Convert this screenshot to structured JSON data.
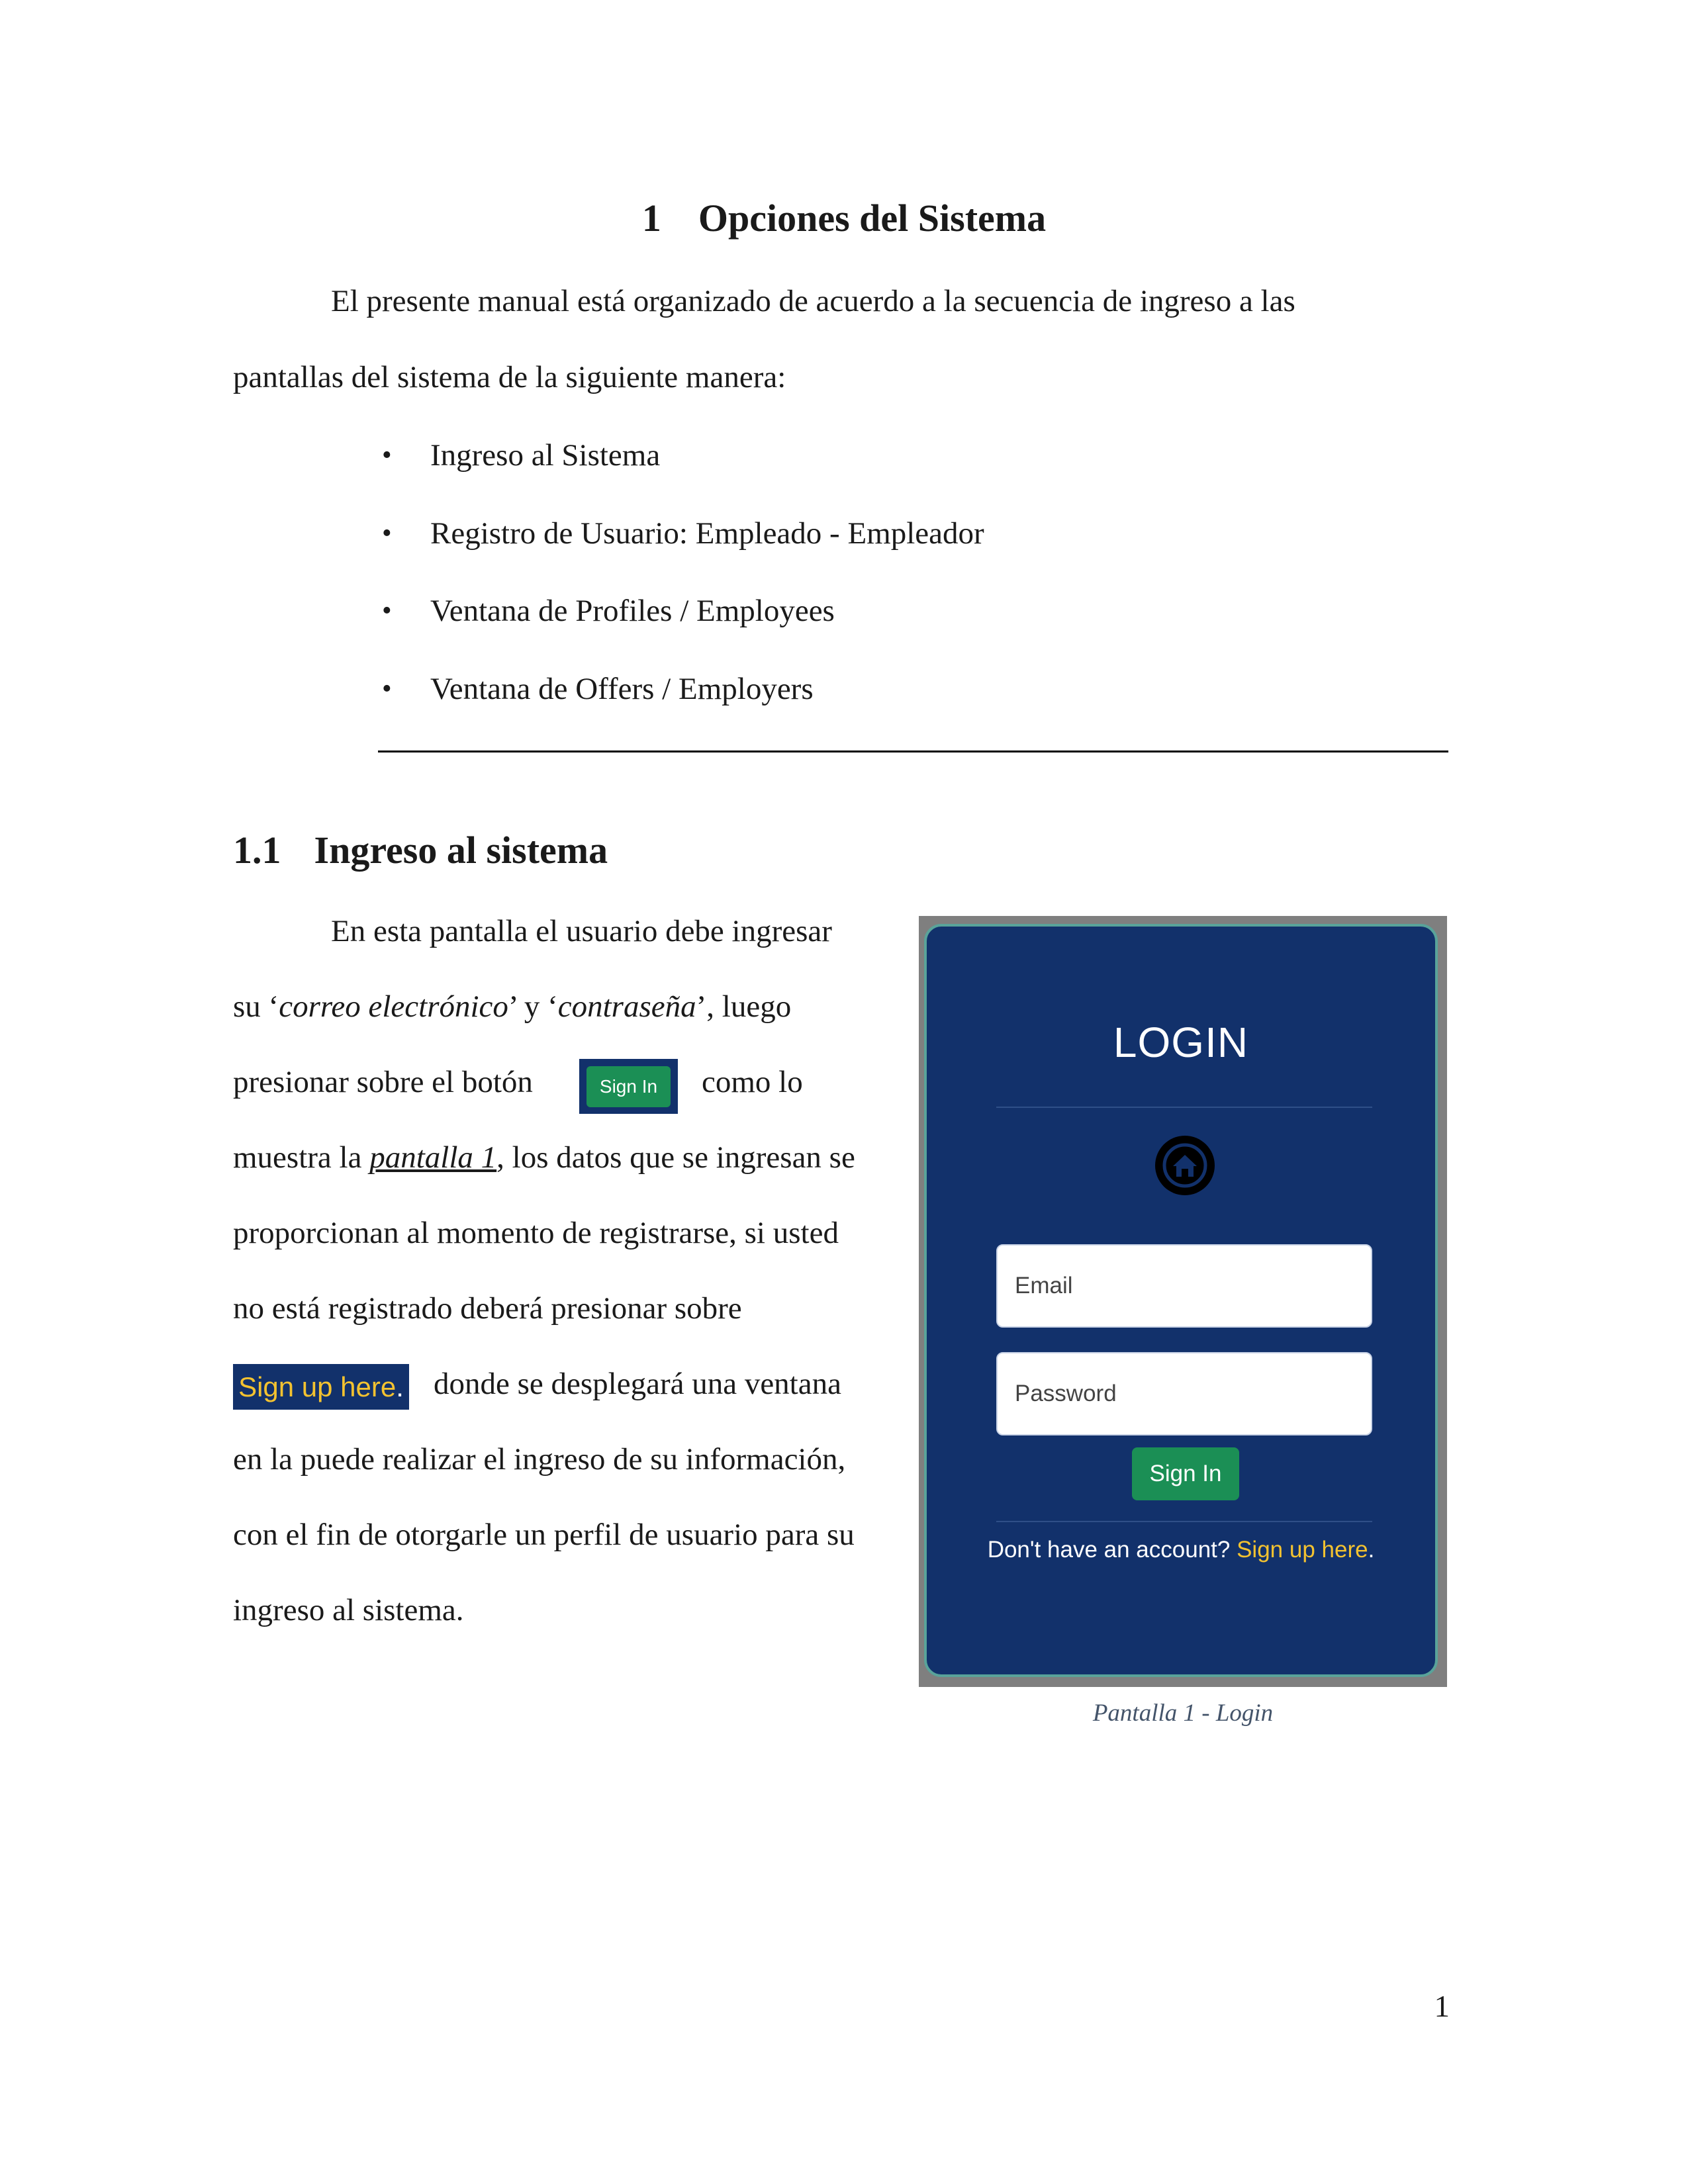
{
  "section": {
    "number": "1",
    "title": "Opciones del Sistema",
    "intro_line1": "El presente manual está organizado de acuerdo a la secuencia de ingreso a las",
    "intro_line2": "pantallas del sistema de la siguiente manera:",
    "bullets": [
      "Ingreso al Sistema",
      "Registro de Usuario: Empleado - Empleador",
      "Ventana de Profiles / Employees",
      "Ventana de Offers / Employers"
    ]
  },
  "subsection": {
    "number": "1.1",
    "title": "Ingreso al sistema",
    "lines": {
      "l1": "En esta pantalla el usuario debe ingresar",
      "l2_a": "su ‘",
      "l2_b": "correo electrónico",
      "l2_c": "’ y ‘",
      "l2_d": "contraseña",
      "l2_e": "’, luego",
      "l3_a": "presionar sobre el botón",
      "l3_b": "como lo",
      "l4_a": "muestra la ",
      "l4_b": "pantalla 1",
      "l4_c": ", los datos que se ingresan se",
      "l5": "proporcionan al momento de registrarse, si usted",
      "l6": "no está registrado deberá presionar sobre",
      "l7": "donde se desplegará una ventana",
      "l8": "en la puede realizar el ingreso de su información,",
      "l9": "con el fin de otorgarle un perfil de usuario para su",
      "l10": "ingreso al sistema."
    },
    "inline_signin_label": "Sign In",
    "inline_signup_link": "Sign up here",
    "inline_signup_dot": "."
  },
  "login_screen": {
    "title": "LOGIN",
    "logo_icon": "house-icon",
    "email_placeholder": "Email",
    "password_placeholder": "Password",
    "signin_label": "Sign In",
    "no_account_text": "Don't have an account? ",
    "signup_link": "Sign up here",
    "signup_dot": ".",
    "colors": {
      "panel": "#12316b",
      "border": "#59a39a",
      "button": "#1b8f55",
      "link": "#f3c230"
    }
  },
  "figure_caption": "Pantalla 1 - Login",
  "page_number": "1"
}
